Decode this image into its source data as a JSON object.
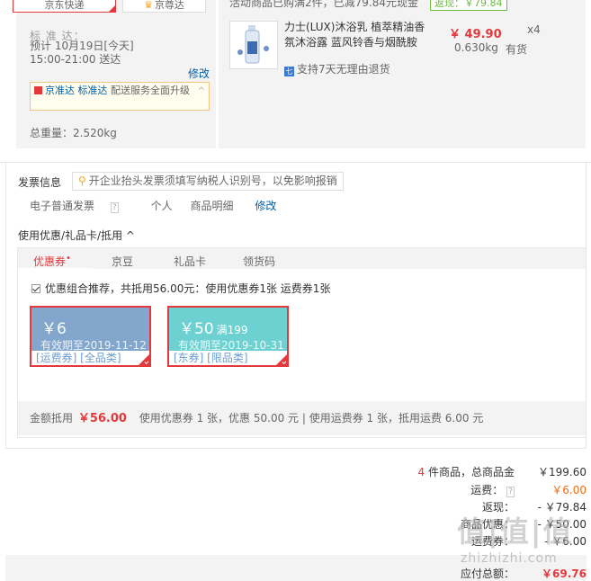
{
  "shipping": {
    "tab_jd": "京东快递",
    "tab_premium": "京尊达",
    "standard_label": "标 准 达：",
    "eta": "预计 10月19日[今天] 15:00-21:00 送达",
    "edit": "修改",
    "notice_brand": "京准达",
    "notice_type": "标准达",
    "notice_text": "配送服务全面升级",
    "total_weight": "总重量：2.520kg"
  },
  "product": {
    "promo": "活动商品已购满2件，已减79.84元现金",
    "cashback": "返现：￥79.84",
    "name": "力士(LUX)沐浴乳 植萃精油香氛沐浴露 蓝风铃香与烟酰胺",
    "price": "￥ 49.90",
    "qty": "x4",
    "weight": "0.630kg",
    "stock": "有货",
    "return_policy": "支持7天无理由退货"
  },
  "invoice": {
    "title": "发票信息",
    "tip": "开企业抬头发票须填写纳税人识别号，以免影响报销",
    "type": "电子普通发票",
    "holder": "个人",
    "content": "商品明细",
    "edit": "修改"
  },
  "coupons": {
    "title": "使用优惠/礼品卡/抵用",
    "tabs": [
      "优惠券",
      "京豆",
      "礼品卡",
      "领货码"
    ],
    "combo": "优惠组合推荐，共抵用56.00元：使用优惠券1张 运费券1张",
    "cards": [
      {
        "amount": "￥6",
        "threshold": "",
        "valid": "有效期至2019-11-12",
        "scope": "[运费券] [全品类]"
      },
      {
        "amount": "￥50",
        "threshold": "满199",
        "valid": "有效期至2019-10-31",
        "scope": "[东券] [限品类]"
      }
    ],
    "summary_label": "金额抵用",
    "summary_amount": "￥56.00",
    "summary_detail": "使用优惠券 1 张，优惠 50.00 元 | 使用运费券 1 张，抵用运费 6.00 元"
  },
  "totals": {
    "item_count": "4",
    "items_label": "件商品，总商品金",
    "items_total": "￥199.60",
    "shipping_label": "运费：",
    "shipping_value": "￥6.00",
    "cashback_label": "返现：",
    "cashback_value": "- ￥79.84",
    "coupon_label": "商品优惠：",
    "coupon_value": "- ￥50.00",
    "freight_coupon_label": "运费券：",
    "freight_coupon_value": "- ￥6.00",
    "payable_label": "应付总额：",
    "payable_value": "￥69.76"
  },
  "watermark": {
    "logo": "值|值|值",
    "url": "zhizhizhi.com"
  }
}
